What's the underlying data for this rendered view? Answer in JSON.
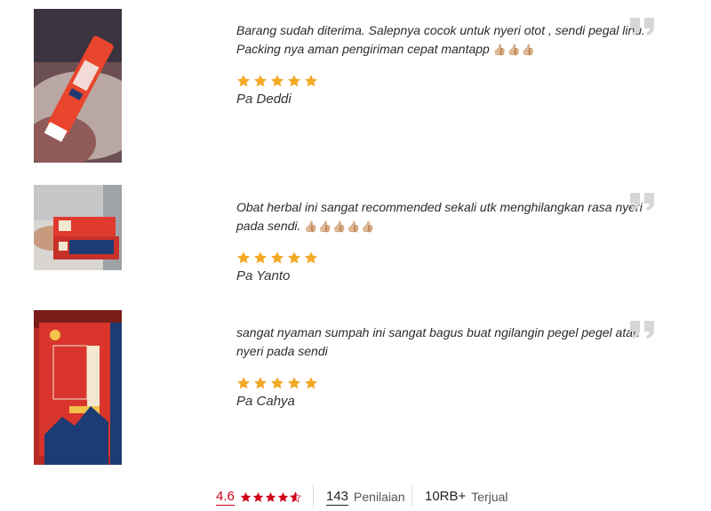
{
  "reviews": [
    {
      "text": "Barang sudah diterima. Salepnya cocok untuk nyeri otot , sendi pegal linu. Packing nya aman pengiriman cepat mantapp",
      "thumbs": "👍🏼👍🏼👍🏼",
      "stars": 5,
      "name": "Pa Deddi",
      "photo_icon": "product-tube-photo"
    },
    {
      "text": "Obat herbal ini sangat recommended sekali utk menghilangkan rasa nyeri pada sendi.",
      "thumbs": "👍🏼👍🏼👍🏼👍🏼👍🏼",
      "stars": 5,
      "name": "Pa Yanto",
      "photo_icon": "product-box-in-hand-photo"
    },
    {
      "text": "sangat nyaman sumpah ini sangat bagus buat ngilangin pegel pegel atau nyeri pada sendi",
      "thumbs": "",
      "stars": 5,
      "name": "Pa Cahya",
      "photo_icon": "product-box-photo"
    }
  ],
  "summary": {
    "rating": "4.6",
    "rating_stars": 4.6,
    "review_count": "143",
    "review_label": "Penilaian",
    "sold_count": "10RB+",
    "sold_label": "Terjual"
  },
  "colors": {
    "star": "#f2a925",
    "rating_red": "#d0011b",
    "brand_orange": "#e8452c"
  }
}
